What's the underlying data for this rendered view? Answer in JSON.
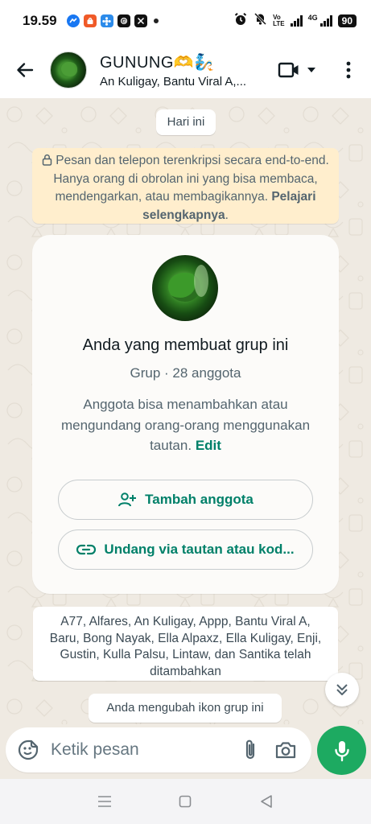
{
  "status_bar": {
    "time": "19.59",
    "app_icons": [
      {
        "name": "messenger-icon",
        "color": "#1877f2",
        "glyph": "~"
      },
      {
        "name": "shopee-icon",
        "color": "#f05a28",
        "glyph": "S"
      },
      {
        "name": "app-icon",
        "color": "#2c8bea",
        "glyph": "✿"
      },
      {
        "name": "threads-icon",
        "color": "#111111",
        "glyph": "@"
      },
      {
        "name": "x-icon",
        "color": "#111111",
        "glyph": "X"
      }
    ],
    "volte_top": "Vo",
    "volte_bottom": "LTE",
    "network": "4G",
    "battery": "90"
  },
  "header": {
    "title": "GUNUNG🫶🧞",
    "subtitle": "An Kuligay, Bantu Viral A,..."
  },
  "chat": {
    "date_pill": "Hari ini",
    "e2e": {
      "text": "Pesan dan telepon terenkripsi secara end-to-end. Hanya orang di obrolan ini yang bisa membaca, mendengarkan, atau membagikannya.",
      "link": "Pelajari selengkapnya",
      "suffix": "."
    },
    "group_card": {
      "title": "Anda yang membuat grup ini",
      "meta": "Grup · 28 anggota",
      "description": "Anggota bisa menambahkan atau mengundang orang-orang menggunakan tautan.",
      "edit_link": "Edit",
      "add_members": "Tambah anggota",
      "invite": "Undang via tautan atau kod..."
    },
    "system_added": "A77, Alfares, An Kuligay, Appp, Bantu Viral A, Baru, Bong Nayak, Ella Alpaxz, Ella Kuligay, Enji, Gustin, Kulla Palsu, Lintaw, dan Santika telah ditambahkan",
    "system_icon_changed": "Anda mengubah ikon grup ini"
  },
  "composer": {
    "placeholder": "Ketik pesan"
  },
  "colors": {
    "accent": "#008069",
    "mic_button": "#1daa61",
    "chat_bg": "#efeae2",
    "e2e_bg": "#ffeecd"
  }
}
